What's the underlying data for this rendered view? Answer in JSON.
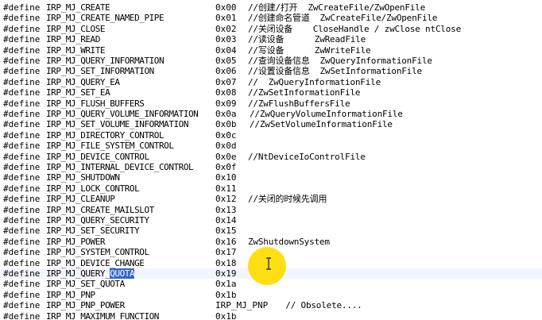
{
  "editor": {
    "keyword": "#define",
    "selection": {
      "row": 25,
      "text": "QUOTA"
    },
    "lines": [
      {
        "name": "IRP_MJ_CREATE",
        "value": "0x00",
        "comment": "//创建/打开  ZwCreateFile/ZwOpenFile"
      },
      {
        "name": "IRP_MJ_CREATE_NAMED_PIPE",
        "value": "0x01",
        "comment": "//创建命名管道  ZwCreateFile/ZwOpenFile"
      },
      {
        "name": "IRP_MJ_CLOSE",
        "value": "0x02",
        "comment": "//关闭设备    CloseHandle / zwClose ntClose"
      },
      {
        "name": "IRP_MJ_READ",
        "value": "0x03",
        "comment": "//读设备      ZwReadFile"
      },
      {
        "name": "IRP_MJ_WRITE",
        "value": "0x04",
        "comment": "//写设备      ZwWriteFile"
      },
      {
        "name": "IRP_MJ_QUERY_INFORMATION",
        "value": "0x05",
        "comment": "//查询设备信息  ZwQueryInformationFile"
      },
      {
        "name": "IRP_MJ_SET_INFORMATION",
        "value": "0x06",
        "comment": "//设置设备信息  ZwSetInformationFile"
      },
      {
        "name": "IRP_MJ_QUERY_EA",
        "value": "0x07",
        "comment": "//  ZwQueryInformationFile"
      },
      {
        "name": "IRP_MJ_SET_EA",
        "value": "0x08",
        "comment": "//ZwSetInformationFile"
      },
      {
        "name": "IRP_MJ_FLUSH_BUFFERS",
        "value": "0x09",
        "comment": "//ZwFlushBuffersFile"
      },
      {
        "name": "IRP_MJ_QUERY_VOLUME_INFORMATION",
        "value": "0x0a",
        "comment": "//ZwQueryVolumeInformationFile"
      },
      {
        "name": "IRP_MJ_SET_VOLUME_INFORMATION",
        "value": "0x0b",
        "comment": "//ZwSetVolumeInformationFile"
      },
      {
        "name": "IRP_MJ_DIRECTORY_CONTROL",
        "value": "0x0c",
        "comment": ""
      },
      {
        "name": "IRP_MJ_FILE_SYSTEM_CONTROL",
        "value": "0x0d",
        "comment": ""
      },
      {
        "name": "IRP_MJ_DEVICE_CONTROL",
        "value": "0x0e",
        "comment": "//NtDeviceIoControlFile"
      },
      {
        "name": "IRP_MJ_INTERNAL_DEVICE_CONTROL",
        "value": "0x0f",
        "comment": ""
      },
      {
        "name": "IRP_MJ_SHUTDOWN",
        "value": "0x10",
        "comment": ""
      },
      {
        "name": "IRP_MJ_LOCK_CONTROL",
        "value": "0x11",
        "comment": ""
      },
      {
        "name": "IRP_MJ_CLEANUP",
        "value": "0x12",
        "comment": "//关闭的时候先调用"
      },
      {
        "name": "IRP_MJ_CREATE_MAILSLOT",
        "value": "0x13",
        "comment": ""
      },
      {
        "name": "IRP_MJ_QUERY_SECURITY",
        "value": "0x14",
        "comment": ""
      },
      {
        "name": "IRP_MJ_SET_SECURITY",
        "value": "0x15",
        "comment": ""
      },
      {
        "name": "IRP_MJ_POWER",
        "value": "0x16",
        "comment": "ZwShutdownSystem"
      },
      {
        "name": "IRP_MJ_SYSTEM_CONTROL",
        "value": "0x17",
        "comment": ""
      },
      {
        "name": "IRP_MJ_DEVICE_CHANGE",
        "value": "0x18",
        "comment": ""
      },
      {
        "name": "IRP_MJ_QUERY_",
        "value": "0x19",
        "comment": ""
      },
      {
        "name": "IRP_MJ_SET_QUOTA",
        "value": "0x1a",
        "comment": ""
      },
      {
        "name": "IRP_MJ_PNP",
        "value": "0x1b",
        "comment": ""
      },
      {
        "name": "IRP_MJ_PNP_POWER",
        "value": "IRP_MJ_PNP",
        "comment": "   // Obsolete...."
      },
      {
        "name": "IRP_MJ_MAXIMUM_FUNCTION",
        "value": "0x1b",
        "comment": ""
      }
    ]
  },
  "cursor": {
    "icon": "text-cursor-icon",
    "highlight_color": "#ffdc00"
  },
  "colors": {
    "selection": "#3366cc",
    "text": "#000000",
    "background": "#ffffff"
  }
}
